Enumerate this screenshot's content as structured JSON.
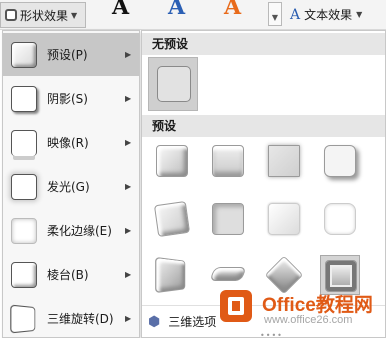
{
  "ribbon": {
    "shape_effects_label": "形状效果",
    "style_letters": [
      "A",
      "A",
      "A"
    ],
    "style_colors": [
      "#111111",
      "#2b5fb4",
      "#e86a1a"
    ],
    "text_effects_label": "文本效果"
  },
  "menu": {
    "items": [
      {
        "label": "预设(P)",
        "icon": "preset-icon",
        "selected": true
      },
      {
        "label": "阴影(S)",
        "icon": "shadow-icon"
      },
      {
        "label": "映像(R)",
        "icon": "reflection-icon"
      },
      {
        "label": "发光(G)",
        "icon": "glow-icon"
      },
      {
        "label": "柔化边缘(E)",
        "icon": "soft-edges-icon"
      },
      {
        "label": "棱台(B)",
        "icon": "bevel-icon"
      },
      {
        "label": "三维旋转(D)",
        "icon": "3d-rotation-icon"
      }
    ]
  },
  "submenu": {
    "no_preset_header": "无预设",
    "preset_header": "预设",
    "preset_count": 12,
    "selected_preset_index": 11,
    "bottom_option_label": "三维选项",
    "bottom_option_icon": "3d-options-icon"
  },
  "watermark": {
    "title": "Office教程网",
    "url": "www.office26.com",
    "color": "#e05a16"
  }
}
